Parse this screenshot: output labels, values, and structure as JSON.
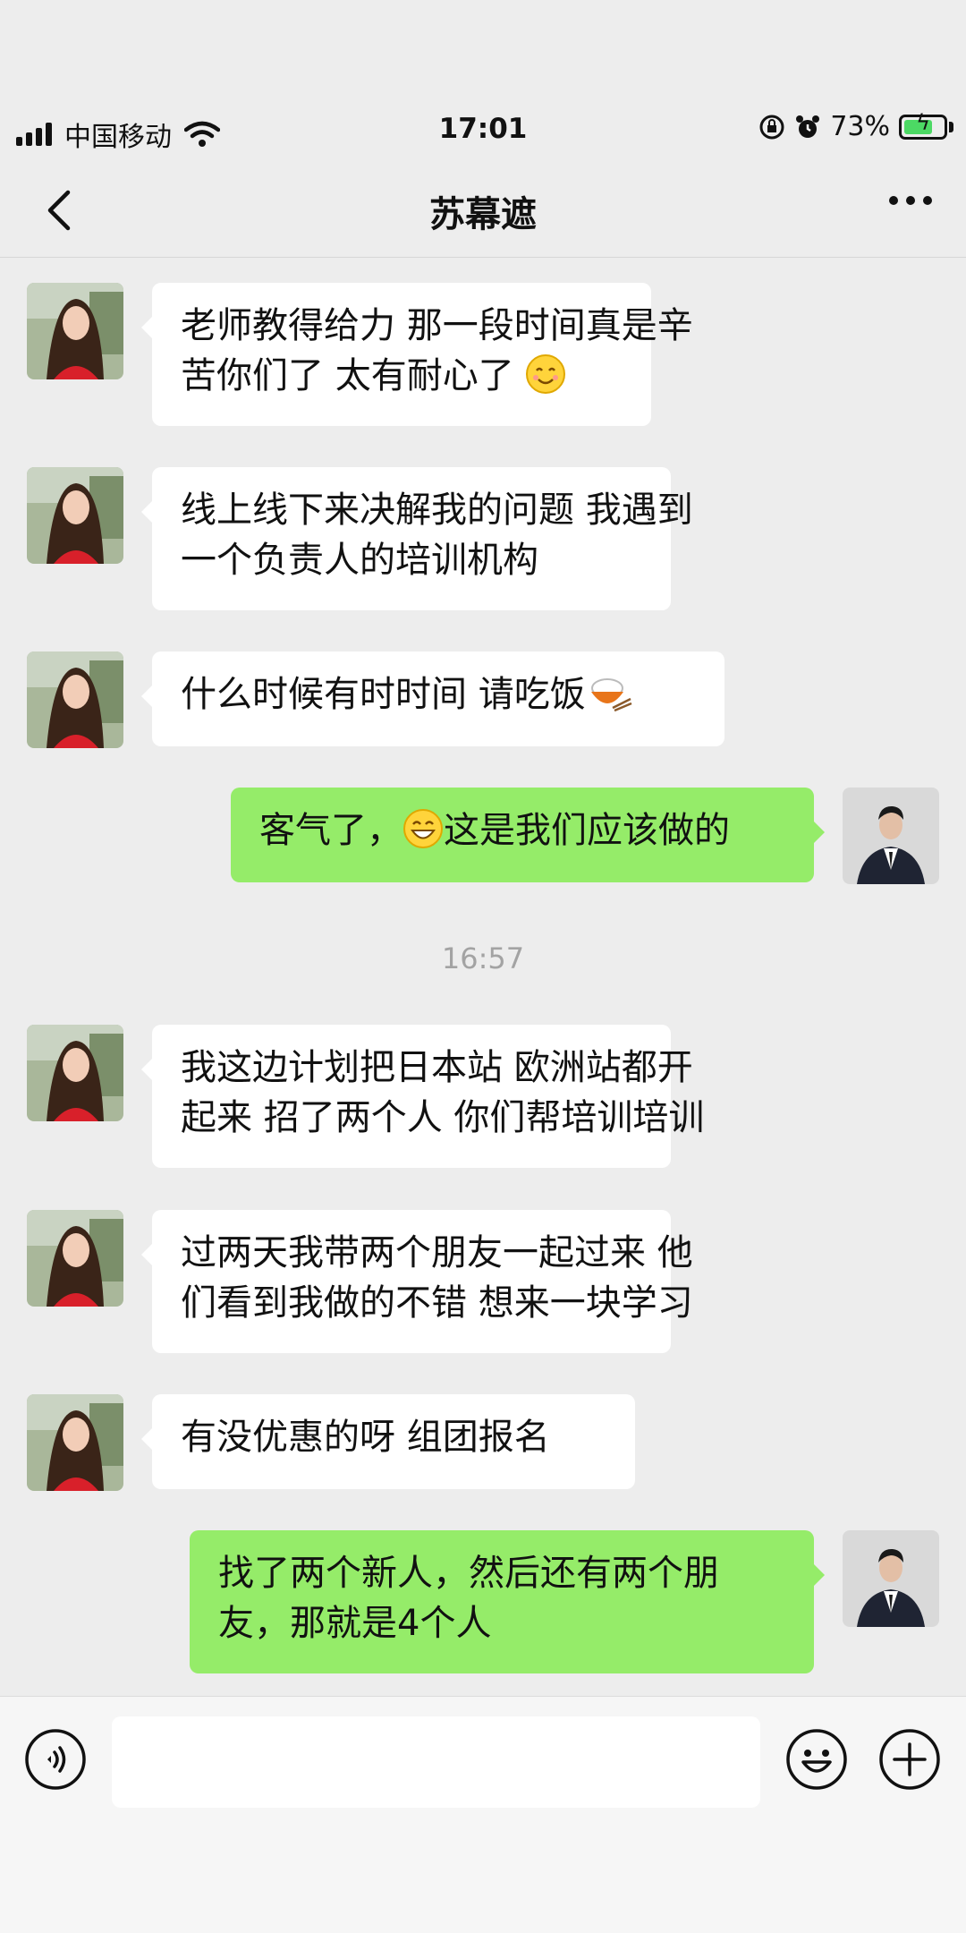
{
  "status_bar": {
    "carrier": "中国移动",
    "time": "17:01",
    "battery": "73%",
    "battery_level": 0.73
  },
  "nav": {
    "title": "苏幕遮"
  },
  "messages": [
    {
      "side": "left",
      "lines": [
        "老师教得给力 那一段时间真是辛",
        "苦你们了  太有耐心了 "
      ],
      "emoji": "smile"
    },
    {
      "side": "left",
      "lines": [
        "线上线下来决解我的问题   我遇到",
        "一个负责人的培训机构"
      ]
    },
    {
      "side": "left",
      "lines": [
        "什么时候有时时间  请吃饭"
      ],
      "emoji": "rice"
    },
    {
      "side": "right",
      "lines": [
        "客气了，",
        "这是我们应该做的"
      ],
      "emoji": "grin"
    },
    {
      "side": "left",
      "lines": [
        "我这边计划把日本站 欧洲站都开",
        "起来 招了两个人 你们帮培训培训"
      ]
    },
    {
      "side": "left",
      "lines": [
        "过两天我带两个朋友一起过来  他",
        "们看到我做的不错 想来一块学习"
      ]
    },
    {
      "side": "left",
      "lines": [
        "有没优惠的呀 组团报名"
      ]
    },
    {
      "side": "right",
      "lines": [
        "找了两个新人，然后还有两个朋",
        "友，那就是4个人"
      ]
    }
  ],
  "timestamp": "16:57",
  "icons": {
    "back": "chevron-left-icon",
    "more": "more-dots-icon",
    "voice": "voice-icon",
    "emoji": "emoji-icon",
    "plus": "plus-icon"
  },
  "colors": {
    "background": "#ededed",
    "incoming_bubble": "#ffffff",
    "outgoing_bubble": "#95ec69",
    "timestamp": "#a3a3a3"
  }
}
